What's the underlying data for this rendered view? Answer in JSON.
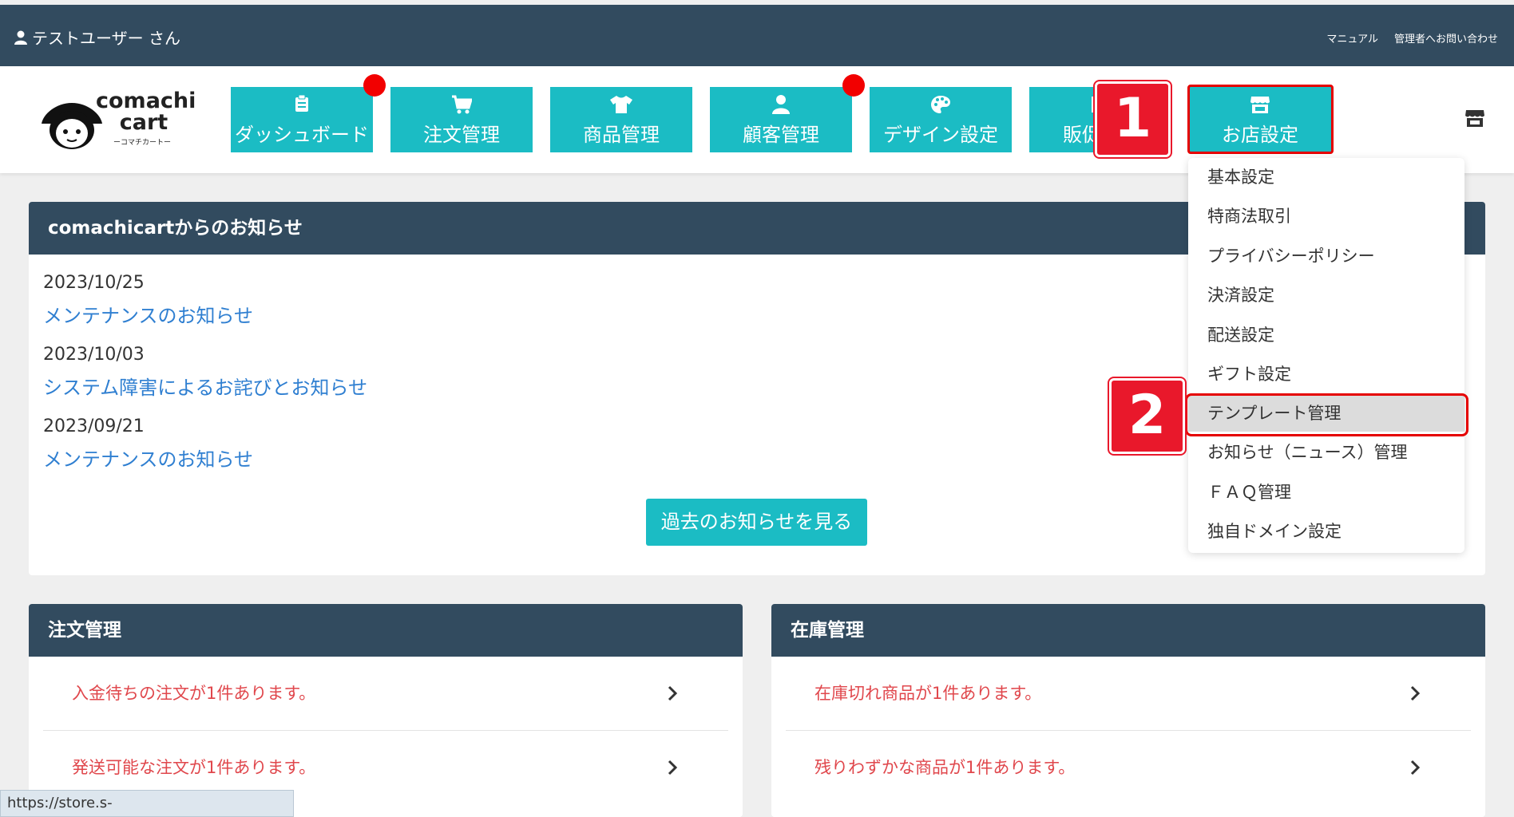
{
  "topbar": {
    "user_label": "テストユーザー さん",
    "manual_link": "マニュアル",
    "contact_link": "管理者へお問い合わせ"
  },
  "logo": {
    "title_line1": "comachi",
    "title_line2": "cart",
    "subtitle": "ーコマチカートー"
  },
  "nav": {
    "items": [
      {
        "label": "ダッシュボード",
        "icon": "clipboard-icon",
        "has_alert_dot": true
      },
      {
        "label": "注文管理",
        "icon": "cart-icon",
        "has_alert_dot": false
      },
      {
        "label": "商品管理",
        "icon": "tshirt-icon",
        "has_alert_dot": false
      },
      {
        "label": "顧客管理",
        "icon": "user-icon",
        "has_alert_dot": true
      },
      {
        "label": "デザイン設定",
        "icon": "palette-icon",
        "has_alert_dot": false
      },
      {
        "label": "販促",
        "icon": "promo-icon",
        "has_alert_dot": false
      },
      {
        "label": "お店設定",
        "icon": "store-icon",
        "has_alert_dot": false
      }
    ],
    "active_item": "お店設定"
  },
  "annotations": {
    "step1": "1",
    "step2": "2",
    "highlight_color": "#e50000"
  },
  "store_menu": {
    "items": [
      "基本設定",
      "特商法取引",
      "プライバシーポリシー",
      "決済設定",
      "配送設定",
      "ギフト設定",
      "テンプレート管理",
      "お知らせ（ニュース）管理",
      "ＦＡＱ管理",
      "独自ドメイン設定"
    ],
    "highlighted_item": "テンプレート管理"
  },
  "notices": {
    "heading": "comachicartからのお知らせ",
    "entries": [
      {
        "date": "2023/10/25",
        "title": "メンテナンスのお知らせ"
      },
      {
        "date": "2023/10/03",
        "title": "システム障害によるお詫びとお知らせ"
      },
      {
        "date": "2023/09/21",
        "title": "メンテナンスのお知らせ"
      }
    ],
    "past_button": "過去のお知らせを見る"
  },
  "orders_panel": {
    "heading": "注文管理",
    "rows": [
      "入金待ちの注文が1件あります。",
      "発送可能な注文が1件あります。"
    ]
  },
  "stock_panel": {
    "heading": "在庫管理",
    "rows": [
      "在庫切れ商品が1件あります。",
      "残りわずかな商品が1件あります。"
    ]
  },
  "status_bar": {
    "url": "https://store.s-flyingfox.com/store/template"
  },
  "colors": {
    "topbar": "#324b5f",
    "accent": "#1bbcc4",
    "link": "#2f7fd1",
    "alert": "#e0474c"
  }
}
